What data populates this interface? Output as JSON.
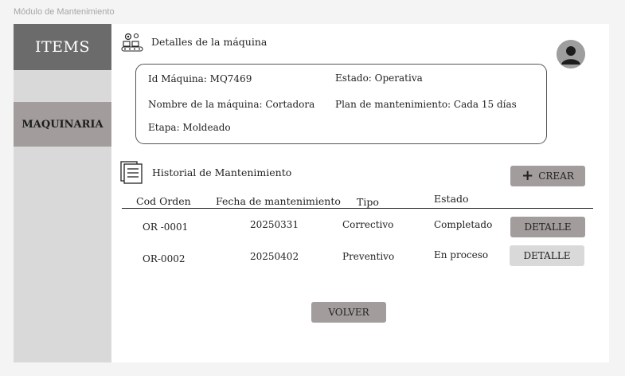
{
  "frame_label": "Módulo de Mantenimiento",
  "sidebar": {
    "items_label": "ITEMS",
    "maquinaria_label": "MAQUINARIA"
  },
  "details": {
    "title": "Detalles de la máquina",
    "id": "Id Máquina: MQ7469",
    "estado": "Estado: Operativa",
    "nombre": "Nombre de la máquina: Cortadora",
    "plan": "Plan de mantenimiento: Cada 15 días",
    "etapa": "Etapa: Moldeado"
  },
  "history": {
    "title": "Historial de Mantenimiento",
    "create_label": "CREAR",
    "columns": [
      "Cod Orden",
      "Fecha de mantenimiento",
      "Tipo",
      "Estado"
    ],
    "rows": [
      {
        "cod": "OR -0001",
        "fecha": "20250331",
        "tipo": "Correctivo",
        "estado": "Completado",
        "action": "DETALLE"
      },
      {
        "cod": "OR-0002",
        "fecha": "20250402",
        "tipo": "Preventivo",
        "estado": "En proceso",
        "action": "DETALLE"
      }
    ]
  },
  "back_label": "VOLVER",
  "icons": {
    "details": "machinery-conveyor-icon",
    "history": "document-list-icon",
    "avatar": "user-avatar-icon",
    "create": "plus-icon"
  },
  "colors": {
    "sidebar_bg": "#d9d9d9",
    "sidebar_active": "#6b6b6b",
    "button_bg": "#a29c9c",
    "button_light": "#d9d9d9"
  }
}
